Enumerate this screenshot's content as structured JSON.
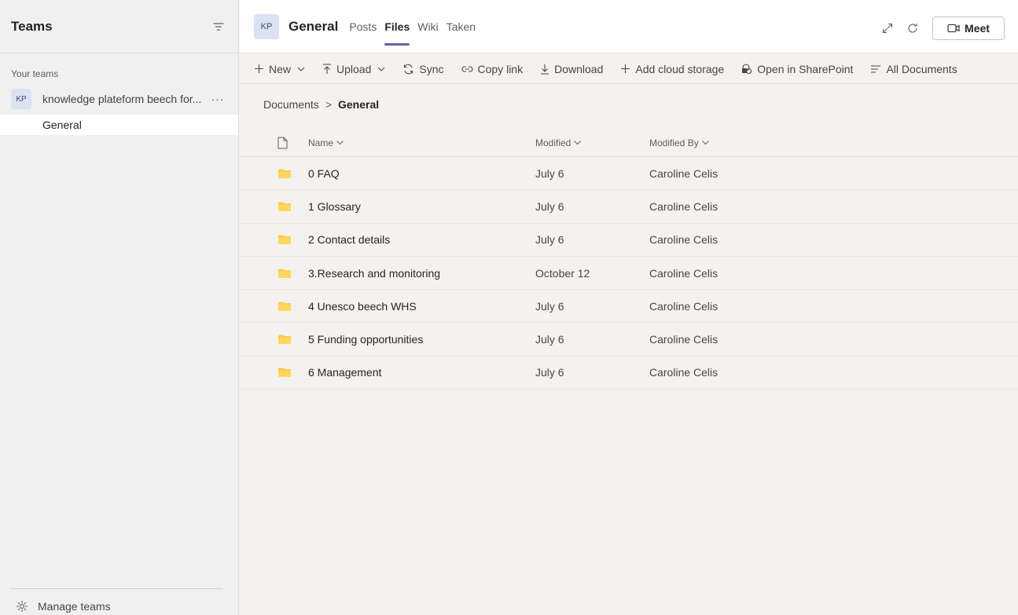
{
  "sidebar": {
    "title": "Teams",
    "section_label": "Your teams",
    "team": {
      "avatar": "KP",
      "name": "knowledge plateform beech for...",
      "more": "···"
    },
    "channel": "General",
    "manage": "Manage teams"
  },
  "header": {
    "avatar": "KP",
    "title": "General",
    "tabs": [
      {
        "label": "Posts",
        "active": false
      },
      {
        "label": "Files",
        "active": true
      },
      {
        "label": "Wiki",
        "active": false
      },
      {
        "label": "Taken",
        "active": false
      }
    ],
    "meet": "Meet"
  },
  "toolbar": {
    "new": "New",
    "upload": "Upload",
    "sync": "Sync",
    "copy_link": "Copy link",
    "download": "Download",
    "add_cloud": "Add cloud storage",
    "open_sp": "Open in SharePoint",
    "all_docs": "All Documents"
  },
  "breadcrumb": {
    "root": "Documents",
    "sep": ">",
    "current": "General"
  },
  "table": {
    "headers": {
      "name": "Name",
      "modified": "Modified",
      "modified_by": "Modified By"
    },
    "rows": [
      {
        "name": "0 FAQ",
        "modified": "July 6",
        "by": "Caroline Celis"
      },
      {
        "name": "1 Glossary",
        "modified": "July 6",
        "by": "Caroline Celis"
      },
      {
        "name": "2 Contact details",
        "modified": "July 6",
        "by": "Caroline Celis"
      },
      {
        "name": "3.Research and monitoring",
        "modified": "October 12",
        "by": "Caroline Celis"
      },
      {
        "name": "4 Unesco beech WHS",
        "modified": "July 6",
        "by": "Caroline Celis"
      },
      {
        "name": "5 Funding opportunities",
        "modified": "July 6",
        "by": "Caroline Celis"
      },
      {
        "name": "6 Management",
        "modified": "July 6",
        "by": "Caroline Celis"
      }
    ]
  },
  "colors": {
    "accent": "#6264a7",
    "folder": "#ffc83d",
    "avatar_bg": "#dbe3f2"
  }
}
